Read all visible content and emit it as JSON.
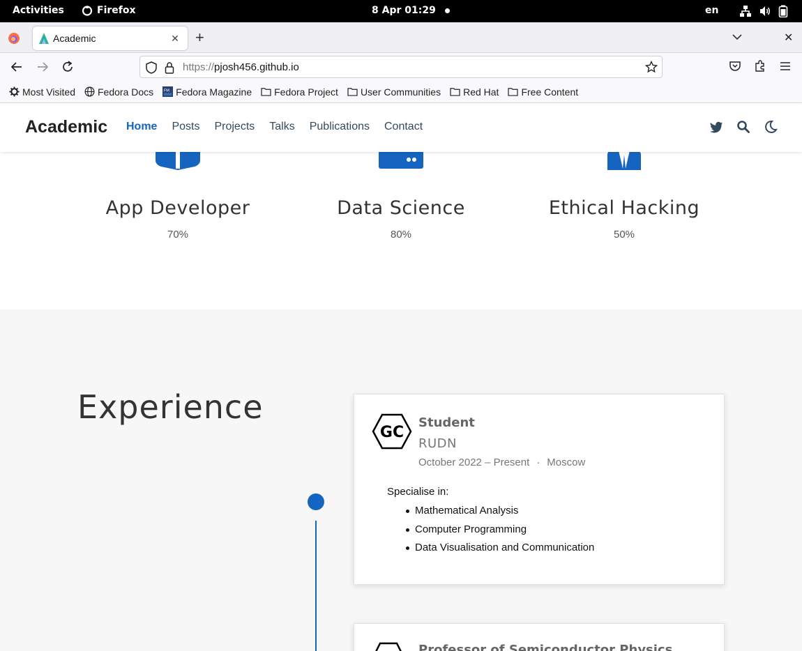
{
  "system": {
    "activities": "Activities",
    "app_name": "Firefox",
    "clock": "8 Apr  01:29",
    "lang": "en"
  },
  "browser": {
    "tab_title": "Academic",
    "url_scheme": "https://",
    "url_host": "pjosh456.github.io",
    "bookmarks": [
      {
        "label": "Most Visited",
        "icon": "gear-icon"
      },
      {
        "label": "Fedora Docs",
        "icon": "globe-icon"
      },
      {
        "label": "Fedora Magazine",
        "icon": "fm-icon"
      },
      {
        "label": "Fedora Project",
        "icon": "folder-icon"
      },
      {
        "label": "User Communities",
        "icon": "folder-icon"
      },
      {
        "label": "Red Hat",
        "icon": "folder-icon"
      },
      {
        "label": "Free Content",
        "icon": "folder-icon"
      }
    ]
  },
  "site": {
    "brand": "Academic",
    "menu": [
      "Home",
      "Posts",
      "Projects",
      "Talks",
      "Publications",
      "Contact"
    ],
    "active_menu": "Home",
    "accent": "#1565c0"
  },
  "skills": [
    {
      "name": "App Developer",
      "percent": "70%",
      "level": 0.7
    },
    {
      "name": "Data Science",
      "percent": "80%",
      "level": 0.8
    },
    {
      "name": "Ethical Hacking",
      "percent": "50%",
      "level": 0.5
    }
  ],
  "experience": {
    "title": "Experience",
    "items": [
      {
        "logo_text": "GC",
        "role": "Student",
        "org": "RUDN",
        "dates": "October 2022 – Present",
        "separator": "·",
        "location": "Moscow",
        "description": "Specialise in:",
        "bullets": [
          "Mathematical Analysis",
          "Computer Programming",
          "Data Visualisation and Communication"
        ]
      },
      {
        "role": "Professor of Semiconductor Physics"
      }
    ]
  }
}
